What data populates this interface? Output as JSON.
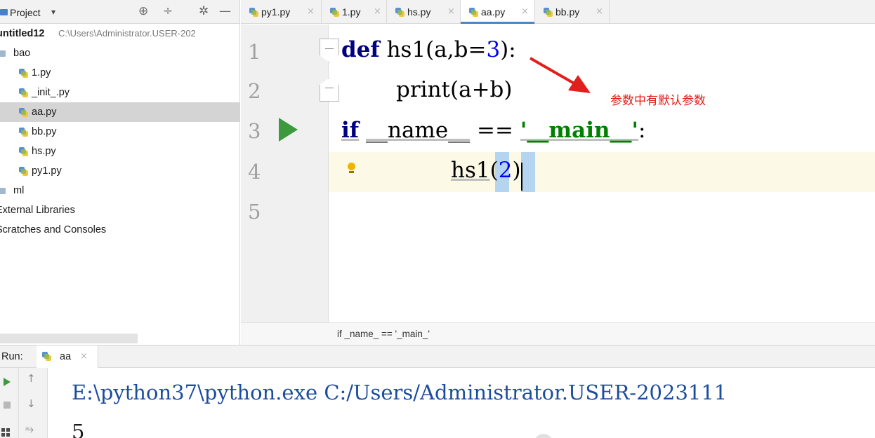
{
  "sidebar": {
    "header": {
      "label": "Project",
      "caret": "▾",
      "icons": [
        "locate-icon",
        "collapse-all-icon",
        "settings-gear-icon",
        "hide-icon"
      ]
    },
    "tree": {
      "root_name": "untitled12",
      "root_path": "C:\\Users\\Administrator.USER-202",
      "folder_bao": "bao",
      "files": [
        "1.py",
        "_init_.py",
        "aa.py",
        "bb.py",
        "hs.py",
        "py1.py"
      ],
      "selected_file": "aa.py",
      "folder_ml": "ml",
      "external_libraries": "External Libraries",
      "scratches": "Scratches and Consoles"
    }
  },
  "tabs": [
    {
      "label": "py1.py",
      "active": false
    },
    {
      "label": "1.py",
      "active": false
    },
    {
      "label": "hs.py",
      "active": false
    },
    {
      "label": "aa.py",
      "active": true
    },
    {
      "label": "bb.py",
      "active": false
    }
  ],
  "tab_close_glyph": "×",
  "editor": {
    "line_numbers": [
      "1",
      "2",
      "3",
      "4",
      "5"
    ],
    "code": {
      "l1_kw": "def",
      "l1_pre": " hs1(a,b=",
      "l1_num": "3",
      "l1_post": "):",
      "l2": "print(a+b)",
      "l3_kw": "if",
      "l3_name": "__name__",
      "l3_op": " == ",
      "l3_str": "'__main__'",
      "l3_colon": ":",
      "l4_a": "hs1",
      "l4_b": "(",
      "l4_num": "2",
      "l4_c": ")"
    },
    "annotation": "参数中有默认参数",
    "annotation_color": "#e0201c"
  },
  "breadcrumb": "if _name_ == '_main_'",
  "run": {
    "label": "Run:",
    "tab_label": "aa",
    "console_command": "E:\\python37\\python.exe C:/Users/Administrator.USER-2023111",
    "console_output": "5"
  },
  "colors": {
    "keyword": "#000080",
    "string": "#008000",
    "number": "#0000ff",
    "accent": "#4a86c8",
    "run_green": "#3c9a3c"
  }
}
